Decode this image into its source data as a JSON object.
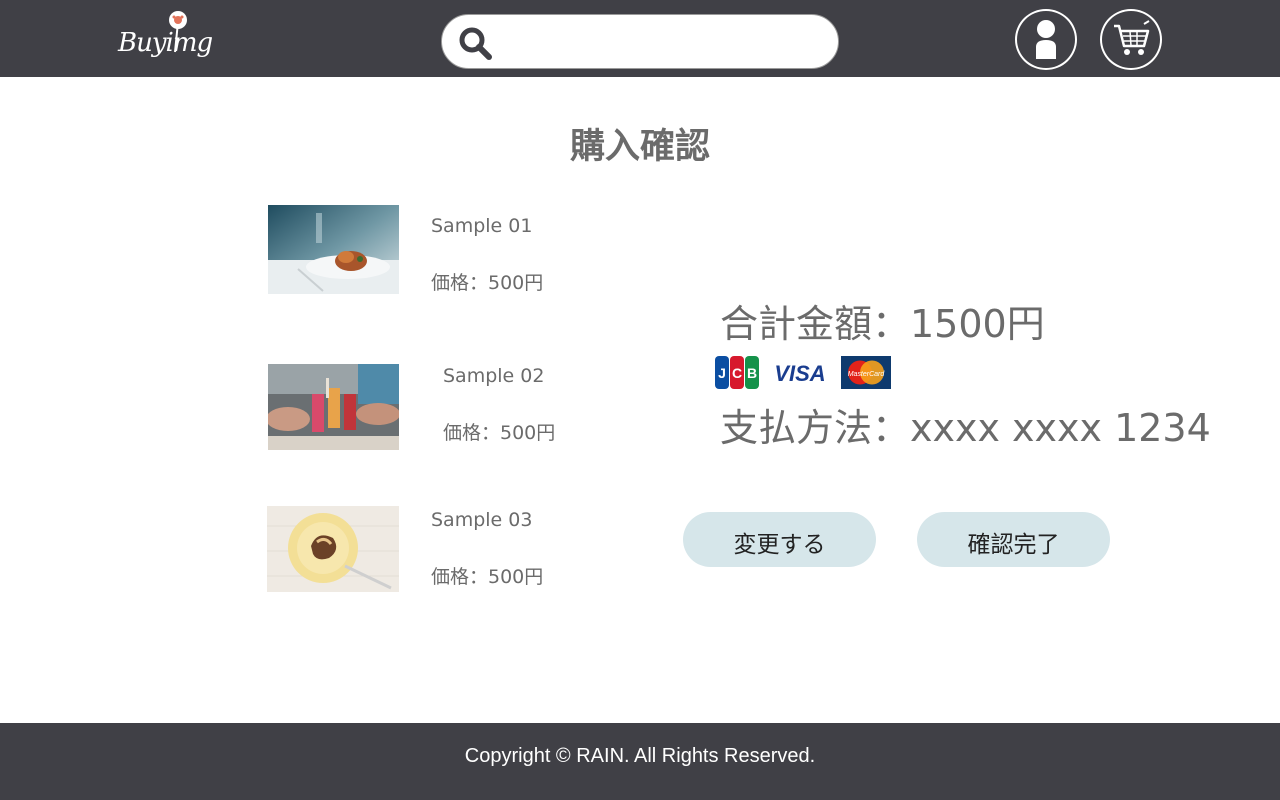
{
  "header": {
    "logo_text": "Buyimg",
    "search": {
      "value": "",
      "placeholder": ""
    },
    "icons": {
      "search": "search-icon",
      "user": "user-icon",
      "cart": "shopping-cart-icon"
    },
    "background": "#404046"
  },
  "page": {
    "title": "購入確認"
  },
  "products": [
    {
      "name": "Sample 01",
      "price": "価格：500円",
      "image": "plated-dish-photo"
    },
    {
      "name": "Sample 02",
      "price": "価格：500円",
      "image": "toasting-drinks-photo"
    },
    {
      "name": "Sample 03",
      "price": "価格：500円",
      "image": "pastry-plate-photo"
    }
  ],
  "summary": {
    "total": "合計金額：1500円",
    "payment": "支払方法：xxxx xxxx 1234",
    "cards": {
      "jcb": "JCB",
      "visa": "VISA",
      "mastercard": "MasterCard"
    }
  },
  "buttons": {
    "change": "変更する",
    "confirm": "確認完了",
    "color": "#d6e6ea"
  },
  "footer": {
    "copyright": "Copyright © RAIN. All Rights Reserved."
  }
}
